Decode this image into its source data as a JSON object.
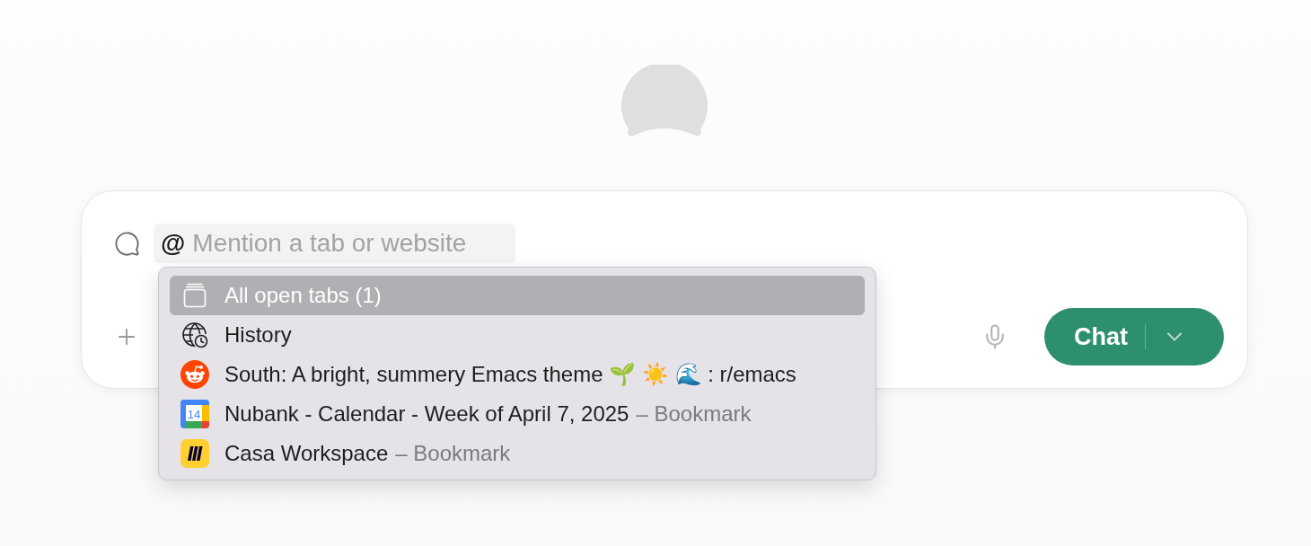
{
  "composer": {
    "mention": {
      "prefix": "@",
      "placeholder": "Mention a tab or website"
    },
    "send_button": {
      "label": "Chat"
    }
  },
  "menu": {
    "items": [
      {
        "kind": "tabs",
        "label": "All open tabs (1)",
        "selected": true
      },
      {
        "kind": "history",
        "label": "History",
        "selected": false
      },
      {
        "kind": "alien",
        "label": "South: A bright, summery Emacs theme 🌱 ☀️ 🌊 : r/emacs",
        "selected": false
      },
      {
        "kind": "calendar",
        "icon_text": "14",
        "label": "Nubank - Calendar - Week of April 7, 2025",
        "suffix": "– Bookmark",
        "selected": false
      },
      {
        "kind": "marks",
        "label": "Casa Workspace",
        "suffix": "– Bookmark",
        "selected": false
      }
    ]
  }
}
